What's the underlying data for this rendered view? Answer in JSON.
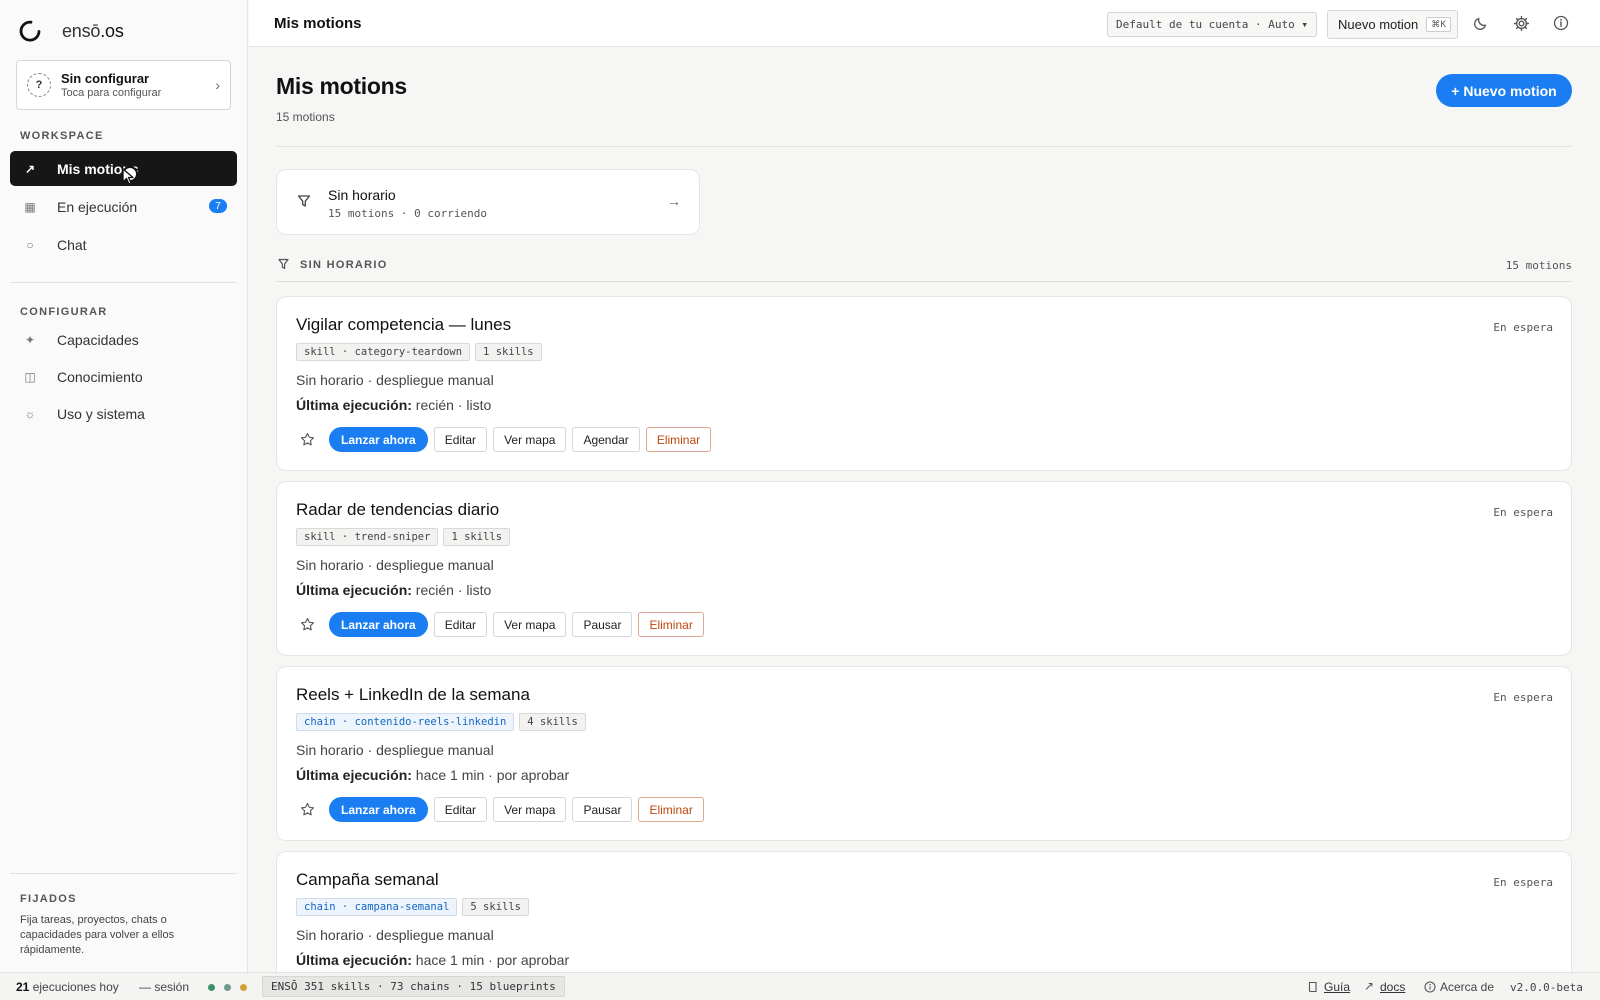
{
  "brand": {
    "name_prefix": "ensō",
    "name_suffix": ".os"
  },
  "setup": {
    "title": "Sin configurar",
    "subtitle": "Toca para configurar",
    "q": "?",
    "chevron": "›"
  },
  "sidebar": {
    "workspace_label": "WORKSPACE",
    "workspace_items": [
      {
        "label": "Mis motions",
        "icon": "arrow-up-right-icon",
        "glyph": "↗",
        "active": true
      },
      {
        "label": "En ejecución",
        "icon": "grid-icon",
        "glyph": "▦",
        "badge": "7"
      },
      {
        "label": "Chat",
        "icon": "circle-icon",
        "glyph": "○"
      }
    ],
    "config_label": "CONFIGURAR",
    "config_items": [
      {
        "label": "Capacidades",
        "icon": "sparkle-icon",
        "glyph": "✦"
      },
      {
        "label": "Conocimiento",
        "icon": "book-icon",
        "glyph": "◫"
      },
      {
        "label": "Uso y sistema",
        "icon": "sun-icon",
        "glyph": "☼"
      }
    ],
    "pinned_label": "FIJADOS",
    "pinned_desc": "Fija tareas, proyectos, chats o capacidades para volver a ellos rápidamente."
  },
  "topbar": {
    "title": "Mis motions",
    "model_select": "Default de tu cuenta · Auto ▾",
    "new_motion": "Nuevo motion",
    "shortcut": "⌘K"
  },
  "main": {
    "title": "Mis motions",
    "count": "15 motions",
    "new_button": "+ Nuevo motion",
    "filter": {
      "title": "Sin horario",
      "subtitle": "15 motions · 0 corriendo",
      "arrow": "→"
    },
    "group": {
      "label": "SIN HORARIO",
      "count": "15 motions"
    },
    "motions": [
      {
        "title": "Vigilar competencia — lunes",
        "status": "En espera",
        "tags": [
          {
            "text": "skill · category-teardown",
            "kind": "skill"
          },
          {
            "text": "1 skills",
            "kind": "count"
          }
        ],
        "schedule": "Sin horario · despliegue manual",
        "last_label": "Última ejecución:",
        "last_value": " recién · listo",
        "actions": [
          "Lanzar ahora",
          "Editar",
          "Ver mapa",
          "Agendar",
          "Eliminar"
        ]
      },
      {
        "title": "Radar de tendencias diario",
        "status": "En espera",
        "tags": [
          {
            "text": "skill · trend-sniper",
            "kind": "skill"
          },
          {
            "text": "1 skills",
            "kind": "count"
          }
        ],
        "schedule": "Sin horario · despliegue manual",
        "last_label": "Última ejecución:",
        "last_value": " recién · listo",
        "actions": [
          "Lanzar ahora",
          "Editar",
          "Ver mapa",
          "Pausar",
          "Eliminar"
        ]
      },
      {
        "title": "Reels + LinkedIn de la semana",
        "status": "En espera",
        "tags": [
          {
            "text": "chain · contenido-reels-linkedin",
            "kind": "chain"
          },
          {
            "text": "4 skills",
            "kind": "count"
          }
        ],
        "schedule": "Sin horario · despliegue manual",
        "last_label": "Última ejecución:",
        "last_value": " hace 1 min · por aprobar",
        "actions": [
          "Lanzar ahora",
          "Editar",
          "Ver mapa",
          "Pausar",
          "Eliminar"
        ]
      },
      {
        "title": "Campaña semanal",
        "status": "En espera",
        "tags": [
          {
            "text": "chain · campana-semanal",
            "kind": "chain"
          },
          {
            "text": "5 skills",
            "kind": "count"
          }
        ],
        "schedule": "Sin horario · despliegue manual",
        "last_label": "Última ejecución:",
        "last_value": " hace 1 min · por aprobar",
        "actions": []
      }
    ]
  },
  "statusbar": {
    "runs_count": "21",
    "runs_label": " ejecuciones hoy",
    "session": "— sesión",
    "dot_colors": [
      "#3f8f6a",
      "#6c9a8b",
      "#d1a23a"
    ],
    "chip": "ENSŌ 351 skills · 73 chains · 15 blueprints",
    "guide": "Guía",
    "docs": "docs",
    "about": "Acerca de",
    "version": "v2.0.0-beta"
  },
  "colors": {
    "accent": "#1a7ef2",
    "danger": "#c0460d",
    "chain": "#1167c6"
  }
}
